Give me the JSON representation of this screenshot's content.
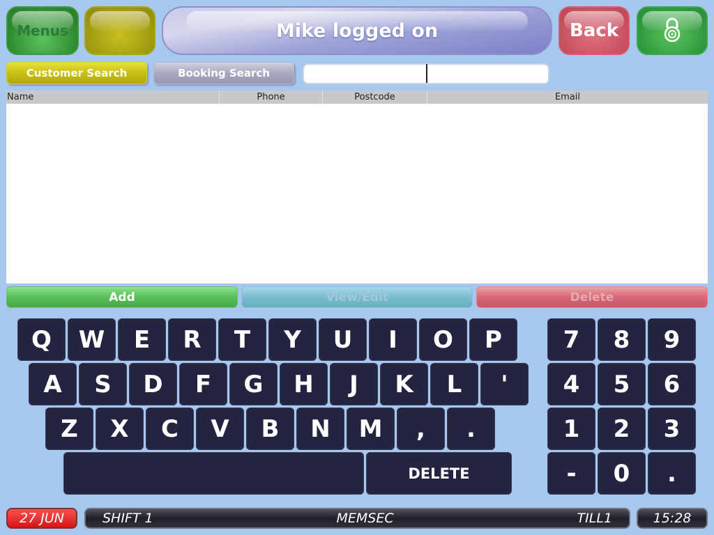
{
  "header": {
    "menus_label": "Menus",
    "title": "Mike logged on",
    "back_label": "Back"
  },
  "search": {
    "customer_search_label": "Customer Search",
    "booking_search_label": "Booking Search",
    "input_value": ""
  },
  "table": {
    "columns": [
      "Name",
      "Phone",
      "Postcode",
      "Email"
    ],
    "rows": []
  },
  "actions": {
    "add_label": "Add",
    "view_edit_label": "View/Edit",
    "delete_label": "Delete"
  },
  "keyboard": {
    "row1": [
      "Q",
      "W",
      "E",
      "R",
      "T",
      "Y",
      "U",
      "I",
      "O",
      "P"
    ],
    "row2": [
      "A",
      "S",
      "D",
      "F",
      "G",
      "H",
      "J",
      "K",
      "L",
      "'"
    ],
    "row3": [
      "Z",
      "X",
      "C",
      "V",
      "B",
      "N",
      "M",
      ",",
      "."
    ],
    "delete_label": "DELETE",
    "numpad": [
      "7",
      "8",
      "9",
      "4",
      "5",
      "6",
      "1",
      "2",
      "3",
      "-",
      "0",
      "."
    ]
  },
  "status": {
    "date": "27 JUN",
    "shift": "SHIFT 1",
    "site": "MEMSEC",
    "till": "TILL1",
    "time": "15:28"
  }
}
